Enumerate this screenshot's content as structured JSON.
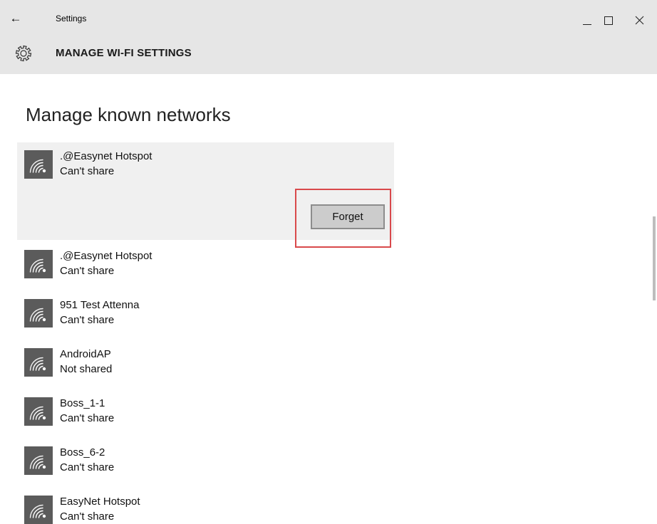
{
  "window": {
    "title": "Settings",
    "back_glyph": "←",
    "controls": [
      "minimize",
      "maximize",
      "close"
    ]
  },
  "header": {
    "icon": "gear-icon",
    "title": "MANAGE WI-FI SETTINGS"
  },
  "page": {
    "heading": "Manage known networks"
  },
  "networks": [
    {
      "name": ".@Easynet Hotspot",
      "status": "Can't share",
      "selected": true,
      "action_label": "Forget"
    },
    {
      "name": ".@Easynet Hotspot",
      "status": "Can't share"
    },
    {
      "name": "951 Test Attenna",
      "status": "Can't share"
    },
    {
      "name": "AndroidAP",
      "status": "Not shared"
    },
    {
      "name": "Boss_1-1",
      "status": "Can't share"
    },
    {
      "name": "Boss_6-2",
      "status": "Can't share"
    },
    {
      "name": "EasyNet Hotspot",
      "status": "Can't share"
    }
  ],
  "colors": {
    "chrome_background": "#e6e6e6",
    "wifi_tile": "#5b5b5b",
    "selected_row": "#f0f0f0",
    "highlight_border": "#d9494b",
    "button_background": "#cccccc"
  }
}
